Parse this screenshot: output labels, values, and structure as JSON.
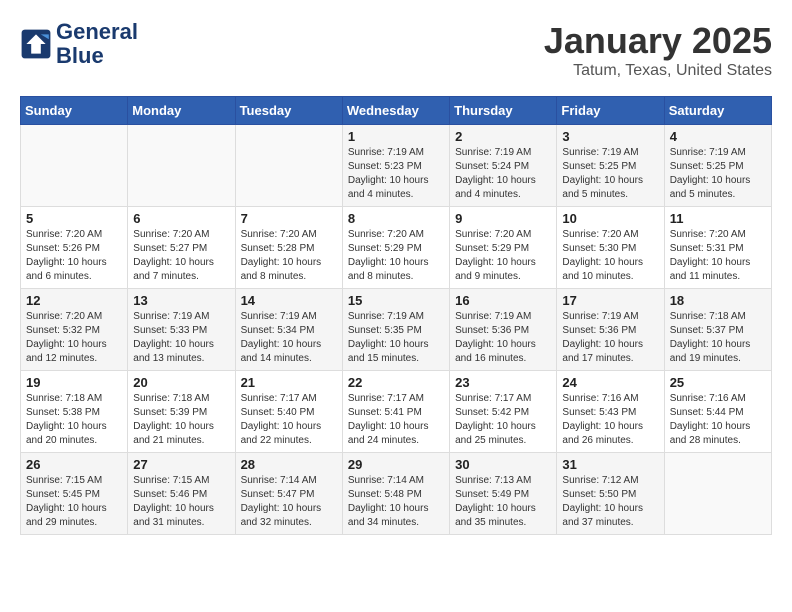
{
  "logo": {
    "line1": "General",
    "line2": "Blue"
  },
  "title": "January 2025",
  "location": "Tatum, Texas, United States",
  "days_of_week": [
    "Sunday",
    "Monday",
    "Tuesday",
    "Wednesday",
    "Thursday",
    "Friday",
    "Saturday"
  ],
  "weeks": [
    [
      {
        "day": "",
        "content": ""
      },
      {
        "day": "",
        "content": ""
      },
      {
        "day": "",
        "content": ""
      },
      {
        "day": "1",
        "content": "Sunrise: 7:19 AM\nSunset: 5:23 PM\nDaylight: 10 hours\nand 4 minutes."
      },
      {
        "day": "2",
        "content": "Sunrise: 7:19 AM\nSunset: 5:24 PM\nDaylight: 10 hours\nand 4 minutes."
      },
      {
        "day": "3",
        "content": "Sunrise: 7:19 AM\nSunset: 5:25 PM\nDaylight: 10 hours\nand 5 minutes."
      },
      {
        "day": "4",
        "content": "Sunrise: 7:19 AM\nSunset: 5:25 PM\nDaylight: 10 hours\nand 5 minutes."
      }
    ],
    [
      {
        "day": "5",
        "content": "Sunrise: 7:20 AM\nSunset: 5:26 PM\nDaylight: 10 hours\nand 6 minutes."
      },
      {
        "day": "6",
        "content": "Sunrise: 7:20 AM\nSunset: 5:27 PM\nDaylight: 10 hours\nand 7 minutes."
      },
      {
        "day": "7",
        "content": "Sunrise: 7:20 AM\nSunset: 5:28 PM\nDaylight: 10 hours\nand 8 minutes."
      },
      {
        "day": "8",
        "content": "Sunrise: 7:20 AM\nSunset: 5:29 PM\nDaylight: 10 hours\nand 8 minutes."
      },
      {
        "day": "9",
        "content": "Sunrise: 7:20 AM\nSunset: 5:29 PM\nDaylight: 10 hours\nand 9 minutes."
      },
      {
        "day": "10",
        "content": "Sunrise: 7:20 AM\nSunset: 5:30 PM\nDaylight: 10 hours\nand 10 minutes."
      },
      {
        "day": "11",
        "content": "Sunrise: 7:20 AM\nSunset: 5:31 PM\nDaylight: 10 hours\nand 11 minutes."
      }
    ],
    [
      {
        "day": "12",
        "content": "Sunrise: 7:20 AM\nSunset: 5:32 PM\nDaylight: 10 hours\nand 12 minutes."
      },
      {
        "day": "13",
        "content": "Sunrise: 7:19 AM\nSunset: 5:33 PM\nDaylight: 10 hours\nand 13 minutes."
      },
      {
        "day": "14",
        "content": "Sunrise: 7:19 AM\nSunset: 5:34 PM\nDaylight: 10 hours\nand 14 minutes."
      },
      {
        "day": "15",
        "content": "Sunrise: 7:19 AM\nSunset: 5:35 PM\nDaylight: 10 hours\nand 15 minutes."
      },
      {
        "day": "16",
        "content": "Sunrise: 7:19 AM\nSunset: 5:36 PM\nDaylight: 10 hours\nand 16 minutes."
      },
      {
        "day": "17",
        "content": "Sunrise: 7:19 AM\nSunset: 5:36 PM\nDaylight: 10 hours\nand 17 minutes."
      },
      {
        "day": "18",
        "content": "Sunrise: 7:18 AM\nSunset: 5:37 PM\nDaylight: 10 hours\nand 19 minutes."
      }
    ],
    [
      {
        "day": "19",
        "content": "Sunrise: 7:18 AM\nSunset: 5:38 PM\nDaylight: 10 hours\nand 20 minutes."
      },
      {
        "day": "20",
        "content": "Sunrise: 7:18 AM\nSunset: 5:39 PM\nDaylight: 10 hours\nand 21 minutes."
      },
      {
        "day": "21",
        "content": "Sunrise: 7:17 AM\nSunset: 5:40 PM\nDaylight: 10 hours\nand 22 minutes."
      },
      {
        "day": "22",
        "content": "Sunrise: 7:17 AM\nSunset: 5:41 PM\nDaylight: 10 hours\nand 24 minutes."
      },
      {
        "day": "23",
        "content": "Sunrise: 7:17 AM\nSunset: 5:42 PM\nDaylight: 10 hours\nand 25 minutes."
      },
      {
        "day": "24",
        "content": "Sunrise: 7:16 AM\nSunset: 5:43 PM\nDaylight: 10 hours\nand 26 minutes."
      },
      {
        "day": "25",
        "content": "Sunrise: 7:16 AM\nSunset: 5:44 PM\nDaylight: 10 hours\nand 28 minutes."
      }
    ],
    [
      {
        "day": "26",
        "content": "Sunrise: 7:15 AM\nSunset: 5:45 PM\nDaylight: 10 hours\nand 29 minutes."
      },
      {
        "day": "27",
        "content": "Sunrise: 7:15 AM\nSunset: 5:46 PM\nDaylight: 10 hours\nand 31 minutes."
      },
      {
        "day": "28",
        "content": "Sunrise: 7:14 AM\nSunset: 5:47 PM\nDaylight: 10 hours\nand 32 minutes."
      },
      {
        "day": "29",
        "content": "Sunrise: 7:14 AM\nSunset: 5:48 PM\nDaylight: 10 hours\nand 34 minutes."
      },
      {
        "day": "30",
        "content": "Sunrise: 7:13 AM\nSunset: 5:49 PM\nDaylight: 10 hours\nand 35 minutes."
      },
      {
        "day": "31",
        "content": "Sunrise: 7:12 AM\nSunset: 5:50 PM\nDaylight: 10 hours\nand 37 minutes."
      },
      {
        "day": "",
        "content": ""
      }
    ]
  ]
}
